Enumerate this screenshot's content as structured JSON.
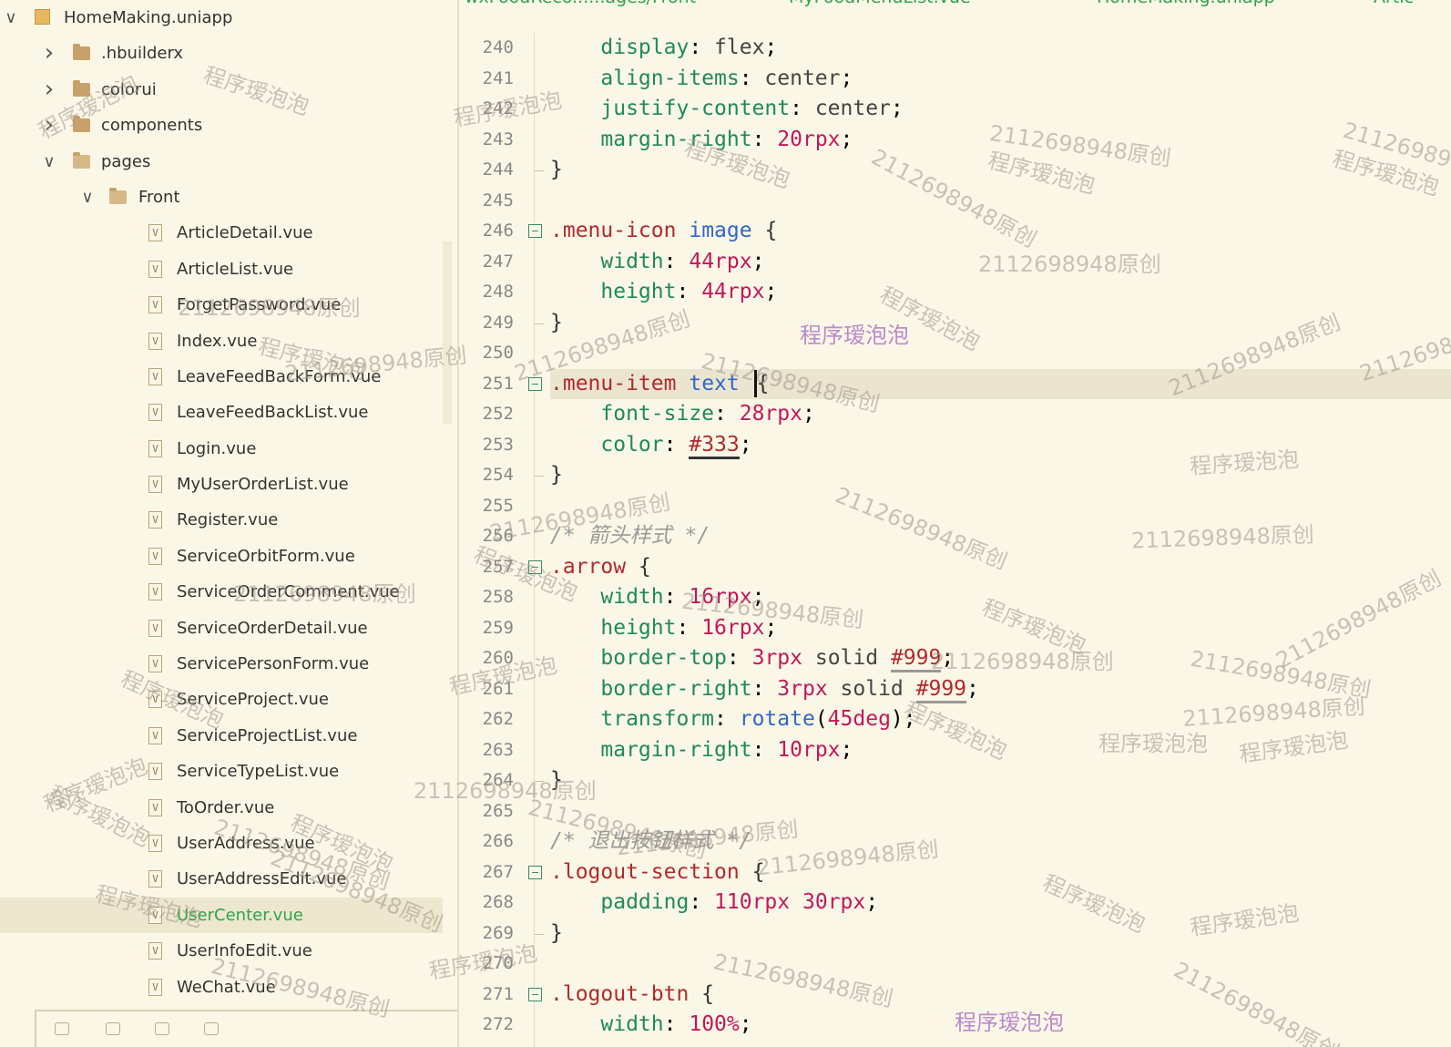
{
  "sidebar": {
    "project": "HomeMaking.uniapp",
    "folders": [
      ".hbuilderx",
      "colorui",
      "components",
      "pages"
    ],
    "subfolder": "Front",
    "files": [
      "ArticleDetail.vue",
      "ArticleList.vue",
      "ForgetPassword.vue",
      "Index.vue",
      "LeaveFeedBackForm.vue",
      "LeaveFeedBackList.vue",
      "Login.vue",
      "MyUserOrderList.vue",
      "Register.vue",
      "ServiceOrbitForm.vue",
      "ServiceOrderComment.vue",
      "ServiceOrderDetail.vue",
      "ServicePersonForm.vue",
      "ServiceProject.vue",
      "ServiceProjectList.vue",
      "ServiceTypeList.vue",
      "ToOrder.vue",
      "UserAddress.vue",
      "UserAddressEdit.vue",
      "UserCenter.vue",
      "UserInfoEdit.vue",
      "WeChat.vue"
    ],
    "selected_file": "UserCenter.vue",
    "file_icon_glyph": "V"
  },
  "editor": {
    "tabs": [
      "wxFoodReco......ages/Front",
      "MyFoodMenuList.vue",
      "HomeMaking.uniapp",
      "Artic"
    ],
    "lines": [
      {
        "n": "240",
        "code": "    display: flex;"
      },
      {
        "n": "241",
        "code": "    align-items: center;"
      },
      {
        "n": "242",
        "code": "    justify-content: center;"
      },
      {
        "n": "243",
        "code": "    margin-right: 20rpx;"
      },
      {
        "n": "244",
        "code": "}"
      },
      {
        "n": "245",
        "code": ""
      },
      {
        "n": "246",
        "code": ".menu-icon image {"
      },
      {
        "n": "247",
        "code": "    width: 44rpx;"
      },
      {
        "n": "248",
        "code": "    height: 44rpx;"
      },
      {
        "n": "249",
        "code": "}"
      },
      {
        "n": "250",
        "code": ""
      },
      {
        "n": "251",
        "code": ".menu-item text {"
      },
      {
        "n": "252",
        "code": "    font-size: 28rpx;"
      },
      {
        "n": "253",
        "code": "    color: #333;"
      },
      {
        "n": "254",
        "code": "}"
      },
      {
        "n": "255",
        "code": ""
      },
      {
        "n": "256",
        "code": "/* 箭头样式 */"
      },
      {
        "n": "257",
        "code": ".arrow {"
      },
      {
        "n": "258",
        "code": "    width: 16rpx;"
      },
      {
        "n": "259",
        "code": "    height: 16rpx;"
      },
      {
        "n": "260",
        "code": "    border-top: 3rpx solid #999;"
      },
      {
        "n": "261",
        "code": "    border-right: 3rpx solid #999;"
      },
      {
        "n": "262",
        "code": "    transform: rotate(45deg);"
      },
      {
        "n": "263",
        "code": "    margin-right: 10rpx;"
      },
      {
        "n": "264",
        "code": "}"
      },
      {
        "n": "265",
        "code": ""
      },
      {
        "n": "266",
        "code": "/* 退出按钮样式 */"
      },
      {
        "n": "267",
        "code": ".logout-section {"
      },
      {
        "n": "268",
        "code": "    padding: 110rpx 30rpx;"
      },
      {
        "n": "269",
        "code": "}"
      },
      {
        "n": "270",
        "code": ""
      },
      {
        "n": "271",
        "code": ".logout-btn {"
      },
      {
        "n": "272",
        "code": "    width: 100%;"
      }
    ],
    "current_line": "251"
  },
  "watermarks": {
    "id_text": "2112698948原创",
    "name_text": "程序瑷泡泡"
  },
  "colors": {
    "background": "#fbf7e6",
    "selector": "#b3292c",
    "property": "#1f8a5b",
    "number": "#c2185b",
    "tag": "#2f68c8",
    "selected_file": "#2fa34a"
  }
}
